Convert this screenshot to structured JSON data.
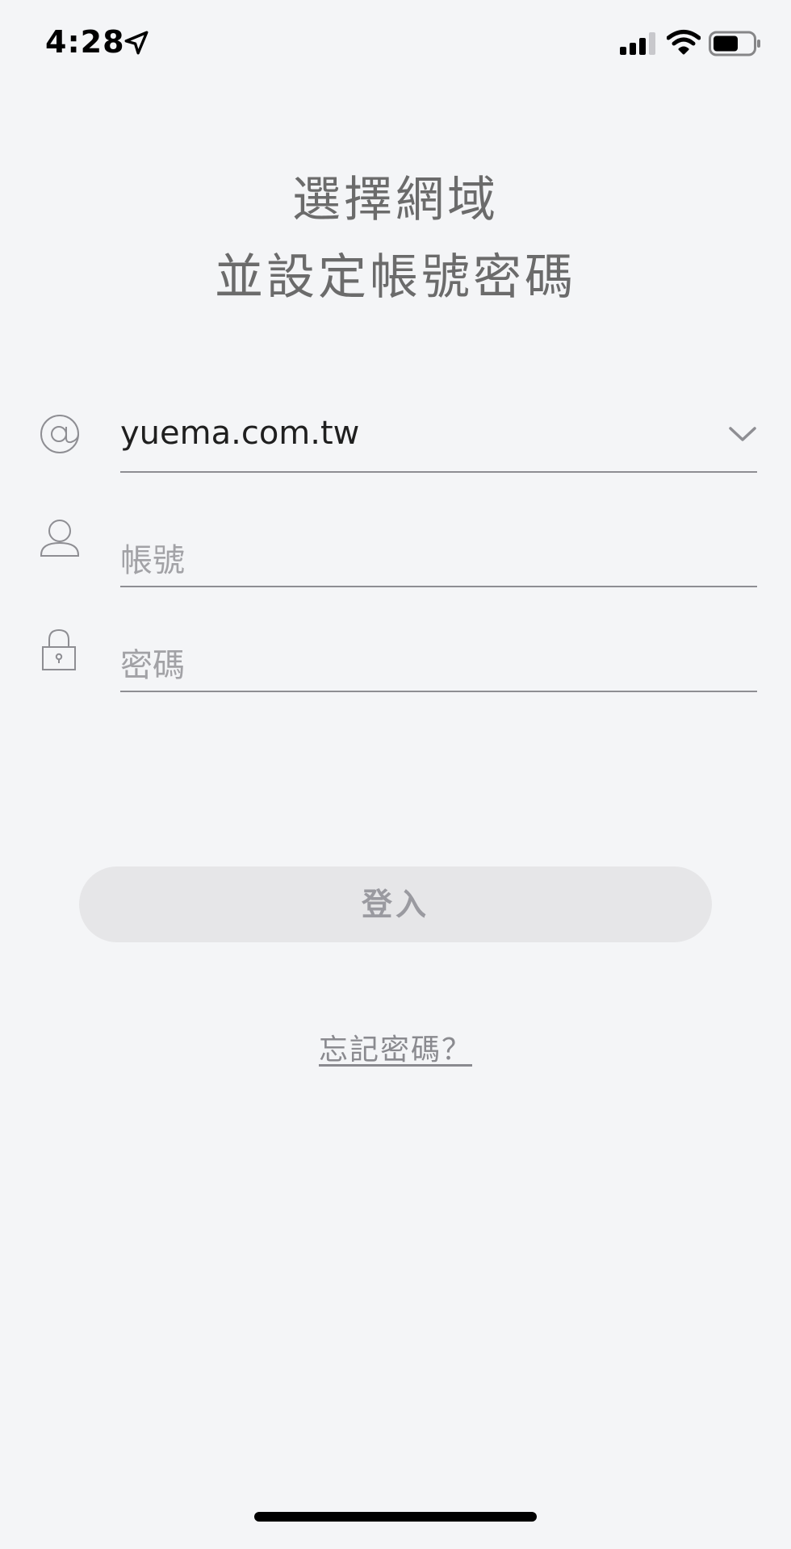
{
  "status_bar": {
    "time": "4:28",
    "icons": [
      "location-arrow-icon",
      "cellular-signal-icon",
      "wifi-icon",
      "battery-icon"
    ]
  },
  "heading": {
    "line1": "選擇網域",
    "line2": "並設定帳號密碼"
  },
  "form": {
    "domain": {
      "icon": "at-sign-icon",
      "value": "yuema.com.tw",
      "dropdown_icon": "chevron-down-icon"
    },
    "account": {
      "icon": "user-icon",
      "placeholder": "帳號"
    },
    "password": {
      "icon": "lock-icon",
      "placeholder": "密碼"
    }
  },
  "login_button": {
    "label": "登入"
  },
  "forgot_password": {
    "label": "忘記密碼？"
  },
  "colors": {
    "background": "#f4f5f7",
    "button_bg": "#e6e6e8",
    "button_text": "#9a9aa0",
    "underline": "#8e8e93"
  }
}
